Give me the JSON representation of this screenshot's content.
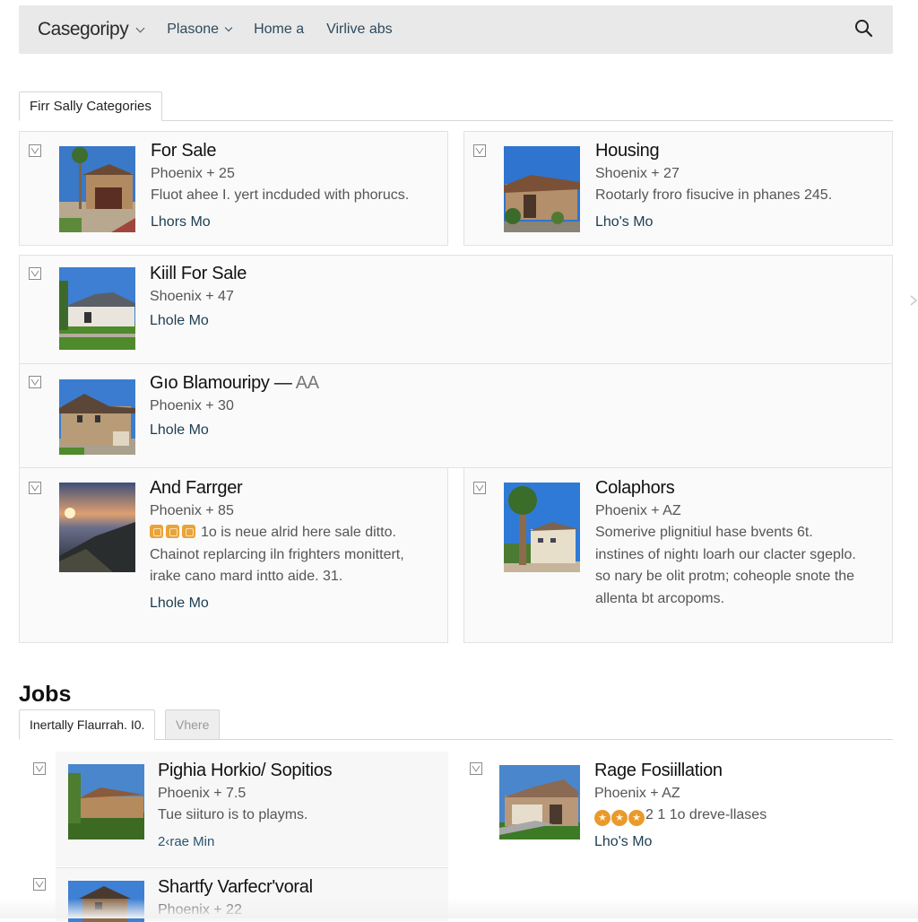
{
  "topbar": {
    "brand": "Casegoripy",
    "nav": [
      {
        "label": "Plasone",
        "has_dropdown": true
      },
      {
        "label": "Home a",
        "has_dropdown": false
      },
      {
        "label": "Virlive abs",
        "has_dropdown": false
      }
    ],
    "search_icon": "search-icon"
  },
  "categories_tab": {
    "label": "Firr Sally Categories"
  },
  "listings": [
    {
      "title": "For Sale",
      "title_suffix": "",
      "location": "Phoenix + 25",
      "description": [
        "Fluot ahee I. yert incduded with phorucs."
      ],
      "link": "Lhors Mo",
      "thumb": "house-palm"
    },
    {
      "title": "Housing",
      "title_suffix": "",
      "location": "Shoenix + 27",
      "description": [
        "Rootarly froro fisucive in phanes 245."
      ],
      "link": "Lho's Mo",
      "thumb": "house-stucco"
    },
    {
      "title": "Kiill For Sale",
      "title_suffix": "",
      "location": "Shoenix + 47",
      "description": [],
      "link": "Lhole Mo",
      "thumb": "house-white"
    },
    {
      "title": "Gıo Blamouripy — ",
      "title_suffix": "AA",
      "location": "Phoenix + 30",
      "description": [],
      "link": "Lhole Mo",
      "thumb": "house-twostory"
    },
    {
      "title": "And Farrger",
      "title_suffix": "",
      "location": "Phoenix + 85",
      "badge_count": 3,
      "description": [
        "1o is neue alrid here sale ditto.",
        "Chainot replarcing iln frighters monittert,",
        "irake cano mard intto aide. 31."
      ],
      "link": "Lhole Mo",
      "thumb": "sunset"
    },
    {
      "title": "Colaphors",
      "title_suffix": "",
      "location": "Phoenix + AZ",
      "description": [
        "Somerive plignitiul hase bvents 6t.",
        "instines of nightı loarh our clacter sgeplo.",
        "so nary be olit protm; coheople snote the",
        "allenta bt arcopoms."
      ],
      "link": "",
      "thumb": "palm-building"
    }
  ],
  "jobs": {
    "heading": "Jobs",
    "tabs": [
      {
        "label": "Inertally Flaurrah. I0.",
        "active": true
      },
      {
        "label": "Vhere",
        "active": false
      }
    ],
    "items": [
      {
        "title": "Pighia Horkio/ Sopitios",
        "location": "Phoenix + 7.5",
        "description": [
          "Tue siituro is to playms."
        ],
        "link": "2‹rae Min",
        "thumb": "villa"
      },
      {
        "title": "Rage Fosiillation",
        "location": "Phoenix + AZ",
        "rating_icons": 3,
        "rating_text": "2 1 1o dreve-llases",
        "link": "Lho's Mo",
        "thumb": "garage-house"
      },
      {
        "title": "Shartfy Varfecr'voral",
        "location": "Phoenix + 22",
        "description": [],
        "link": "",
        "thumb": "wood-house"
      }
    ]
  },
  "colors": {
    "topbar_bg": "#e9e9e9",
    "link": "#1d3d52",
    "nav_text": "#2c4a5e",
    "badge": "#e9a33b"
  }
}
